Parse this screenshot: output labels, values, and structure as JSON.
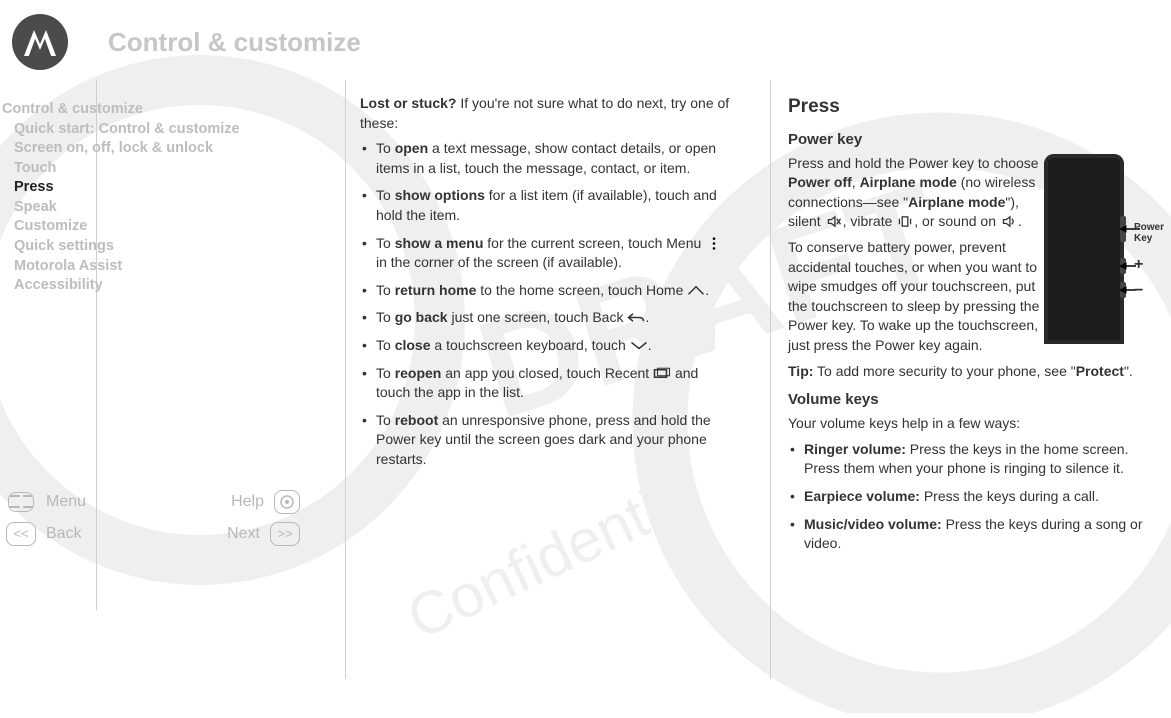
{
  "header": {
    "title": "Control & customize"
  },
  "sidebar": {
    "items": [
      {
        "label": "Control & customize",
        "indent": false,
        "active": false
      },
      {
        "label": "Quick start: Control & customize",
        "indent": true,
        "active": false
      },
      {
        "label": "Screen on, off, lock & unlock",
        "indent": true,
        "active": false
      },
      {
        "label": "Touch",
        "indent": true,
        "active": false
      },
      {
        "label": "Press",
        "indent": true,
        "active": true
      },
      {
        "label": "Speak",
        "indent": true,
        "active": false
      },
      {
        "label": "Customize",
        "indent": true,
        "active": false
      },
      {
        "label": "Quick settings",
        "indent": true,
        "active": false
      },
      {
        "label": "Motorola Assist",
        "indent": true,
        "active": false
      },
      {
        "label": "Accessibility",
        "indent": true,
        "active": false
      }
    ]
  },
  "main": {
    "intro_prefix": "Lost or stuck?",
    "intro_rest": " If you're not sure what to do next, try one of these:",
    "bullets": [
      {
        "pre": "To ",
        "bold": "open",
        "post": " a text message, show contact details, or open items in a list, touch the message, contact, or item."
      },
      {
        "pre": "To ",
        "bold": "show options",
        "post": " for a list item (if available), touch and hold the item."
      },
      {
        "pre": "To ",
        "bold": "show a menu",
        "post_a": " for the current screen, touch Menu ",
        "icon": "menu-dots",
        "post_b": " in the corner of the screen (if available)."
      },
      {
        "pre": "To ",
        "bold": "return home",
        "post_a": " to the home screen, touch Home ",
        "icon": "home",
        "post_b": "."
      },
      {
        "pre": "To ",
        "bold": "go back",
        "post_a": " just one screen, touch Back ",
        "icon": "back",
        "post_b": "."
      },
      {
        "pre": "To ",
        "bold": "close",
        "post_a": " a touchscreen keyboard, touch ",
        "icon": "chevron-down",
        "post_b": "."
      },
      {
        "pre": "To ",
        "bold": "reopen",
        "post_a": " an app you closed, touch Recent ",
        "icon": "recent",
        "post_b": " and touch the app in the list."
      },
      {
        "pre": "To ",
        "bold": "reboot",
        "post": " an unresponsive phone, press and hold the Power key until the screen goes dark and your phone restarts."
      }
    ]
  },
  "right": {
    "section_title": "Press",
    "power": {
      "heading": "Power key",
      "p1_a": "Press and hold the Power key to choose ",
      "p1_b1": "Power off",
      "p1_sep": ", ",
      "p1_b2": "Airplane mode",
      "p1_c": " (no wireless connections—see \"",
      "p1_b3": "Airplane mode",
      "p1_d": "\"), silent ",
      "p1_e": ", vibrate ",
      "p1_f": ", or sound on ",
      "p1_g": ".",
      "p2": "To conserve battery power, prevent accidental touches, or when you want to wipe smudges off your touchscreen, put the touchscreen to sleep by pressing the Power key. To wake up the touchscreen, just press the Power key again.",
      "tip_label": "Tip:",
      "tip_rest": " To add more security to your phone, see \"",
      "tip_link": "Protect",
      "tip_end": "\"."
    },
    "volume": {
      "heading": "Volume keys",
      "intro": "Your volume keys help in a few ways:",
      "items": [
        {
          "bold": "Ringer volume:",
          "rest": " Press the keys in the home screen. Press them when your phone is ringing to silence it."
        },
        {
          "bold": "Earpiece volume:",
          "rest": " Press the keys during a call."
        },
        {
          "bold": "Music/video volume:",
          "rest": " Press the keys during a song or video."
        }
      ]
    },
    "phone_label_l1": "Power",
    "phone_label_l2": "Key"
  },
  "footer": {
    "menu": "Menu",
    "help": "Help",
    "back": "Back",
    "next": "Next"
  }
}
